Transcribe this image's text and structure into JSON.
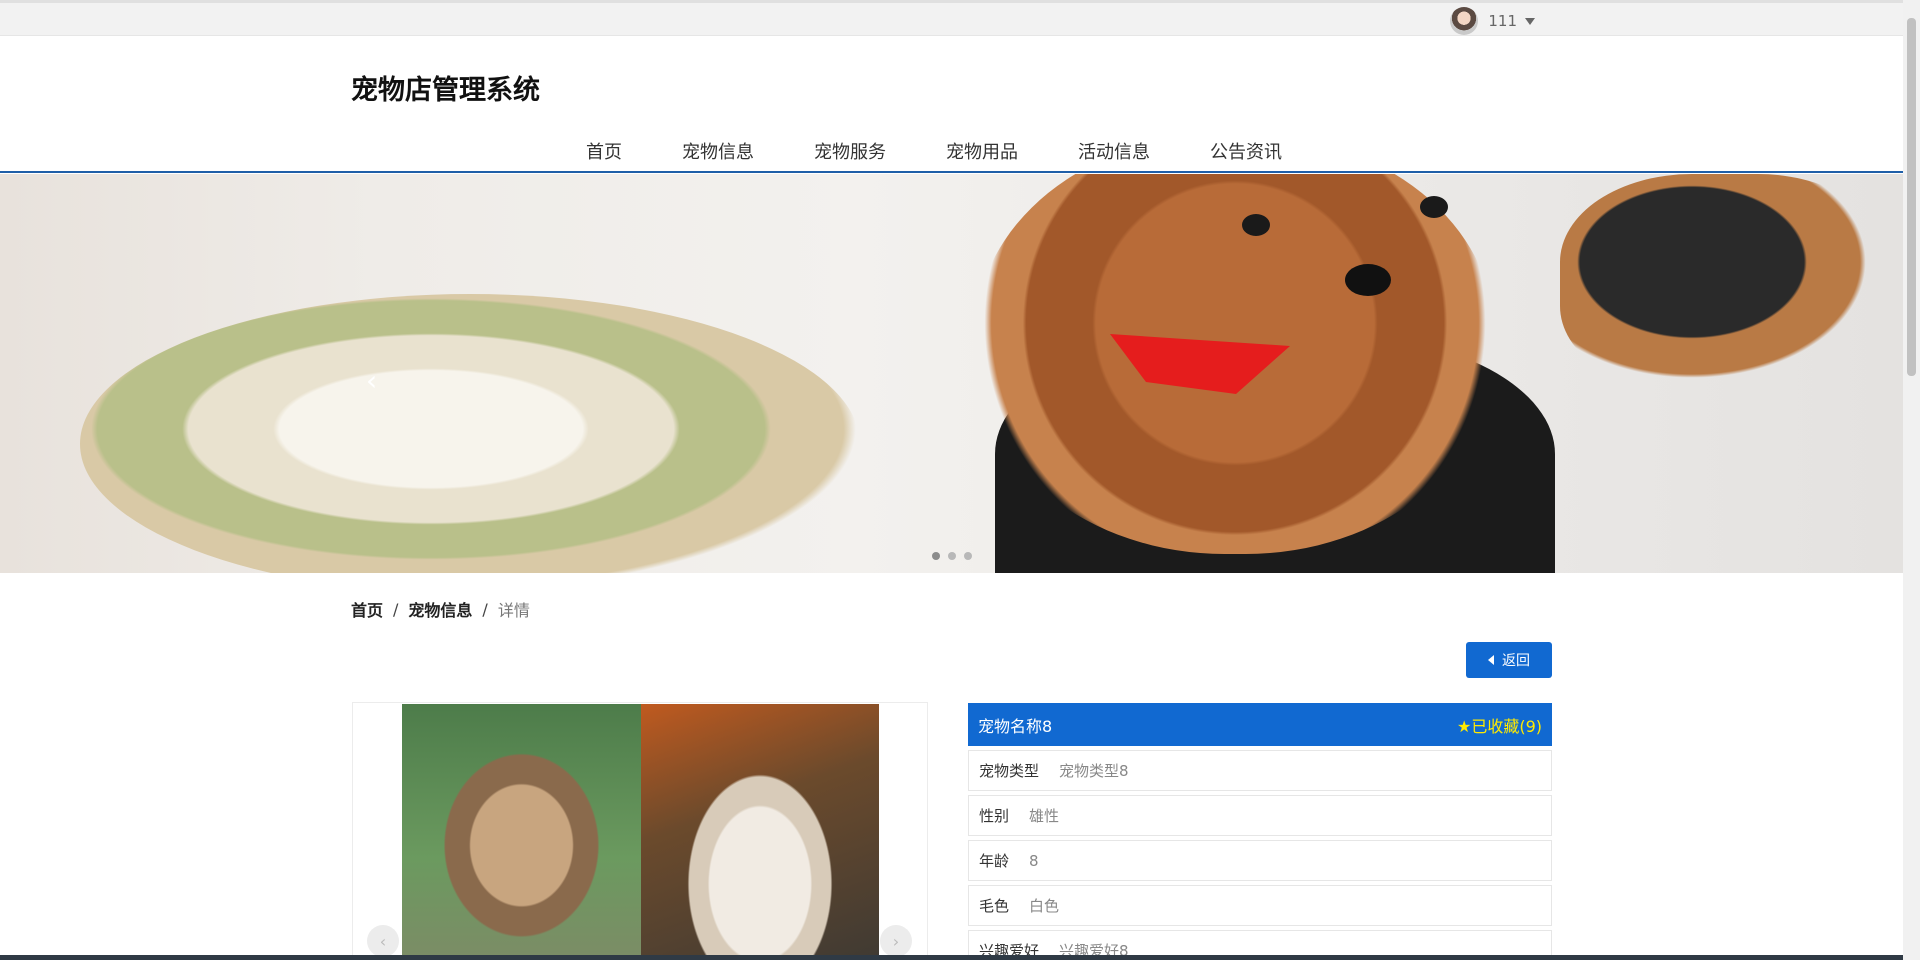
{
  "user": {
    "name": "111"
  },
  "header": {
    "title": "宠物店管理系统",
    "nav": [
      "首页",
      "宠物信息",
      "宠物服务",
      "宠物用品",
      "活动信息",
      "公告资讯"
    ]
  },
  "banner": {
    "prev_icon": "‹"
  },
  "breadcrumb": [
    "首页",
    "宠物信息",
    "详情"
  ],
  "back_button": {
    "label": "返回"
  },
  "detail": {
    "name": "宠物名称8",
    "favorite": "已收藏(9)",
    "fields": [
      {
        "label": "宠物类型",
        "value": "宠物类型8"
      },
      {
        "label": "性别",
        "value": "雄性"
      },
      {
        "label": "年龄",
        "value": "8"
      },
      {
        "label": "毛色",
        "value": "白色"
      },
      {
        "label": "兴趣爱好",
        "value": "兴趣爱好8"
      }
    ]
  },
  "gallery": {
    "prev_icon": "‹",
    "next_icon": "›"
  },
  "colors": {
    "primary": "#1169d1",
    "favorite": "#ffea00",
    "header_line": "#1f5fa8"
  }
}
